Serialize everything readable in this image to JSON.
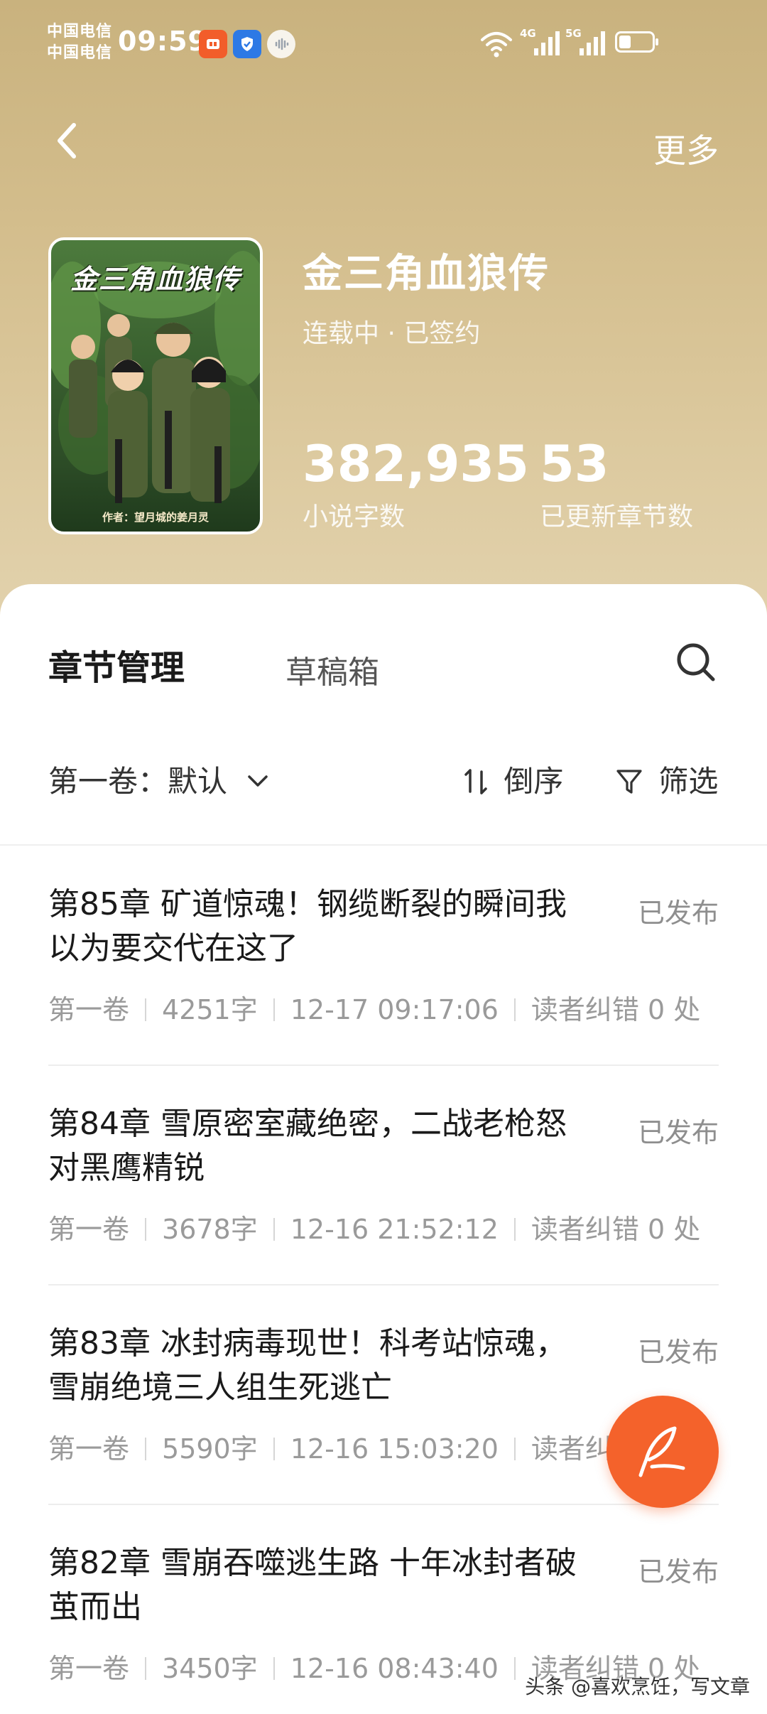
{
  "status_bar": {
    "carrier_1": "中国电信",
    "carrier_2": "中国电信",
    "time": "09:59",
    "net_4g": "4G",
    "net_5g": "5G"
  },
  "nav": {
    "more_label": "更多"
  },
  "book": {
    "cover_title": "金三角血狼传",
    "cover_author": "作者：望月城的姜月灵",
    "title": "金三角血狼传",
    "status": "连载中 · 已签约",
    "word_count": "382,935",
    "word_count_label": "小说字数",
    "chapter_count": "53",
    "chapter_count_label": "已更新章节数"
  },
  "tabs": {
    "active": "章节管理",
    "inactive": "草稿箱"
  },
  "toolbar": {
    "volume_label": "第一卷：默认",
    "sort_label": "倒序",
    "filter_label": "筛选"
  },
  "chapters": [
    {
      "title": "第85章 矿道惊魂！钢缆断裂的瞬间我以为要交代在这了",
      "status": "已发布",
      "volume": "第一卷",
      "words": "4251字",
      "time": "12-17 09:17:06",
      "errors": "读者纠错 0 处"
    },
    {
      "title": "第84章 雪原密室藏绝密，二战老枪怒对黑鹰精锐",
      "status": "已发布",
      "volume": "第一卷",
      "words": "3678字",
      "time": "12-16 21:52:12",
      "errors": "读者纠错 0 处"
    },
    {
      "title": "第83章 冰封病毒现世！科考站惊魂，雪崩绝境三人组生死逃亡",
      "status": "已发布",
      "volume": "第一卷",
      "words": "5590字",
      "time": "12-16 15:03:20",
      "errors": "读者纠错 0 处"
    },
    {
      "title": "第82章 雪崩吞噬逃生路 十年冰封者破茧而出",
      "status": "已发布",
      "volume": "第一卷",
      "words": "3450字",
      "time": "12-16 08:43:40",
      "errors": "读者纠错 0 处"
    }
  ],
  "watermark": "头条 @喜欢烹饪，写文章",
  "colors": {
    "header_gold": "#d3bd8c",
    "fab_orange": "#f4622b",
    "muted_text": "#9a9a9a"
  },
  "icons": {
    "back": "chevron-left-icon",
    "search": "search-icon",
    "volume_dropdown": "chevron-down-icon",
    "sort": "sort-icon",
    "filter": "funnel-icon",
    "fab": "quill-icon"
  }
}
